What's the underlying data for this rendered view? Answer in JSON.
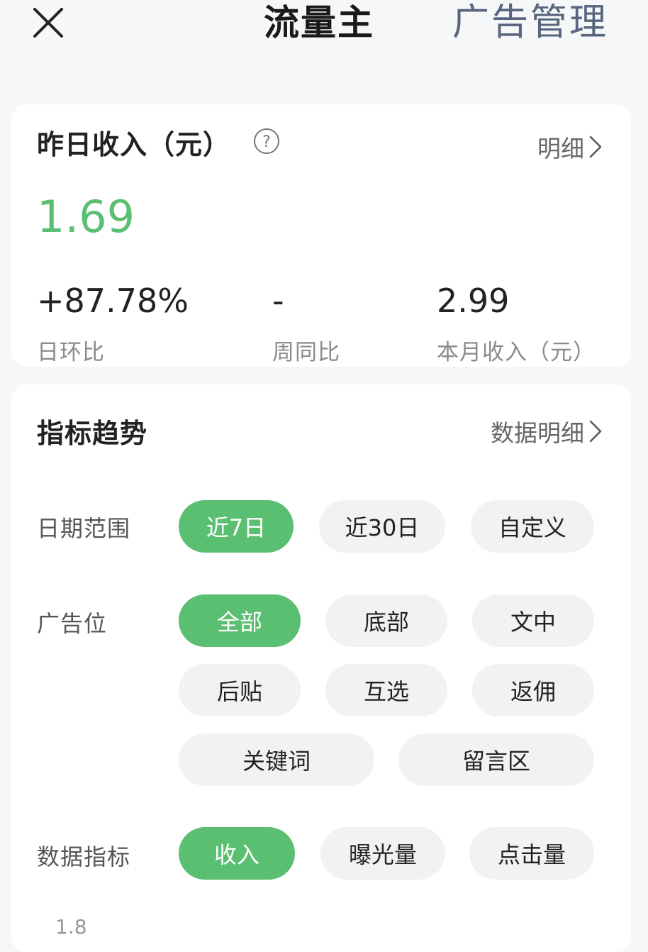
{
  "header": {
    "title": "流量主",
    "ad_manage": "广告管理"
  },
  "income": {
    "title": "昨日收入（元）",
    "detail_link": "明细",
    "yesterday_value": "1.69",
    "stats": [
      {
        "value": "+87.78%",
        "label": "日环比"
      },
      {
        "value": "-",
        "label": "周同比"
      },
      {
        "value": "2.99",
        "label": "本月收入（元）"
      }
    ]
  },
  "trend": {
    "title": "指标趋势",
    "detail_link": "数据明细",
    "date_range": {
      "label": "日期范围",
      "options": [
        "近7日",
        "近30日",
        "自定义"
      ],
      "selected": "近7日"
    },
    "ad_position": {
      "label": "广告位",
      "options": [
        "全部",
        "底部",
        "文中",
        "后贴",
        "互选",
        "返佣",
        "关键词",
        "留言区"
      ],
      "selected": "全部"
    },
    "metric": {
      "label": "数据指标",
      "options": [
        "收入",
        "曝光量",
        "点击量"
      ],
      "selected": "收入"
    },
    "chart_axis_top": "1.8"
  },
  "colors": {
    "accent": "#5bbf72",
    "link": "#57657e",
    "chip_bg": "#f2f2f2"
  }
}
